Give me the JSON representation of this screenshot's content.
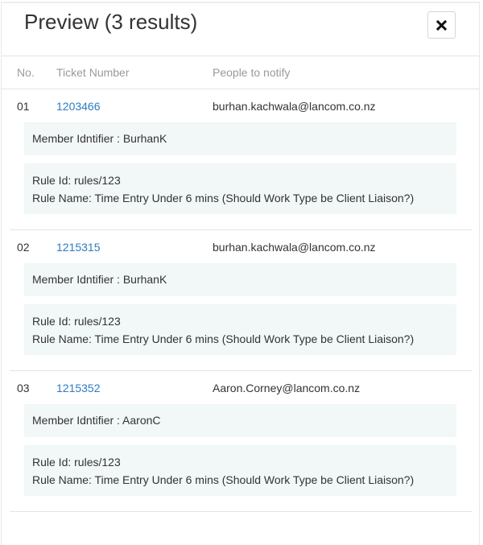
{
  "header": {
    "title": "Preview (3 results)",
    "close_icon": "close-icon"
  },
  "columns": {
    "no": "No.",
    "ticket": "Ticket Number",
    "notify": "People to notify"
  },
  "results": [
    {
      "number": "01",
      "ticket": "1203466",
      "email": "burhan.kachwala@lancom.co.nz",
      "member": "Member Idntifier : BurhanK",
      "rule_id": "Rule Id: rules/123",
      "rule_name": "Rule Name: Time Entry Under 6 mins (Should Work Type be Client Liaison?)"
    },
    {
      "number": "02",
      "ticket": "1215315",
      "email": "burhan.kachwala@lancom.co.nz",
      "member": "Member Idntifier : BurhanK",
      "rule_id": "Rule Id: rules/123",
      "rule_name": "Rule Name: Time Entry Under 6 mins (Should Work Type be Client Liaison?)"
    },
    {
      "number": "03",
      "ticket": "1215352",
      "email": "Aaron.Corney@lancom.co.nz",
      "member": "Member Idntifier : AaronC",
      "rule_id": "Rule Id: rules/123",
      "rule_name": "Rule Name: Time Entry Under 6 mins (Should Work Type be Client Liaison?)"
    }
  ],
  "colors": {
    "link": "#2e7bc2",
    "detail_background": "#f2f7f7",
    "muted_text": "#9a9a9a"
  }
}
